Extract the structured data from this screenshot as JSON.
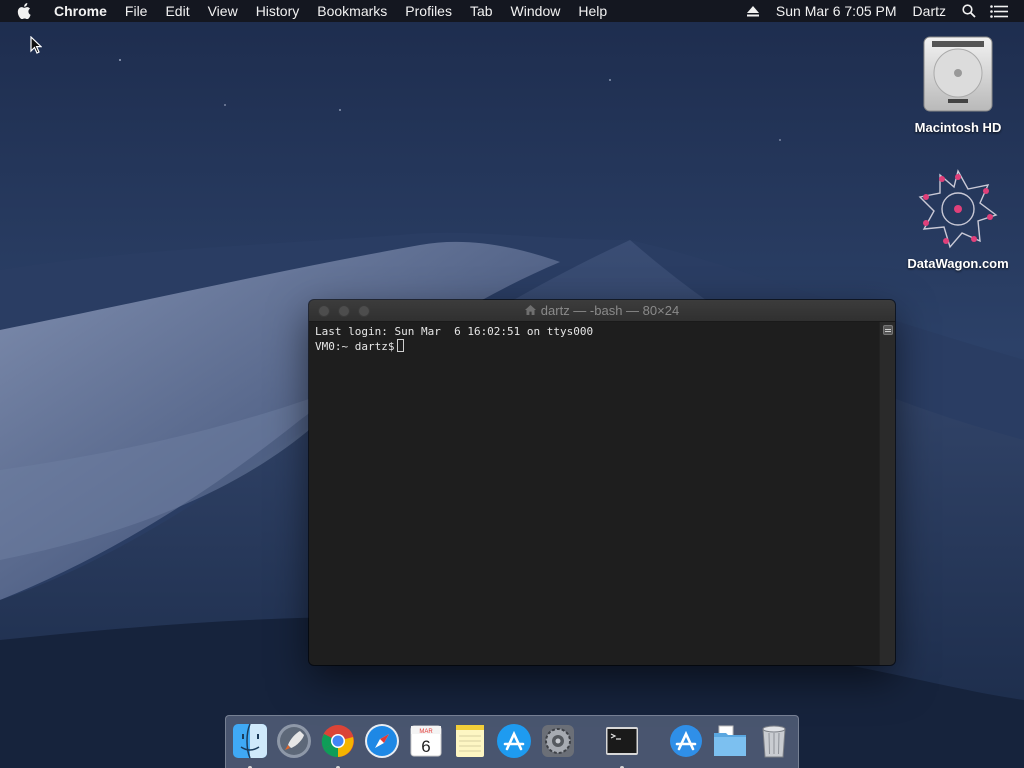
{
  "menubar": {
    "app_name": "Chrome",
    "items": [
      "File",
      "Edit",
      "View",
      "History",
      "Bookmarks",
      "Profiles",
      "Tab",
      "Window",
      "Help"
    ],
    "datetime": "Sun Mar 6  7:05 PM",
    "user": "Dartz"
  },
  "desktop": {
    "icons": [
      {
        "label": "Macintosh HD",
        "icon": "hard-drive-icon"
      },
      {
        "label": "DataWagon.com",
        "icon": "datawagon-logo-icon"
      }
    ]
  },
  "terminal": {
    "title": "dartz — -bash — 80×24",
    "lines": [
      "Last login: Sun Mar  6 16:02:51 on ttys000",
      "VM0:~ dartz$"
    ]
  },
  "dock": {
    "items": [
      {
        "name": "Finder",
        "icon": "finder-icon",
        "running": true
      },
      {
        "name": "Launchpad",
        "icon": "launchpad-icon",
        "running": false
      },
      {
        "name": "Google Chrome",
        "icon": "chrome-icon",
        "running": true
      },
      {
        "name": "Safari",
        "icon": "safari-icon",
        "running": false
      },
      {
        "name": "Calendar",
        "icon": "calendar-icon",
        "running": false,
        "month": "MAR",
        "day": "6"
      },
      {
        "name": "Notes",
        "icon": "notes-icon",
        "running": false
      },
      {
        "name": "App Store",
        "icon": "app-store-icon",
        "running": false
      },
      {
        "name": "System Preferences",
        "icon": "system-preferences-icon",
        "running": false
      },
      {
        "name": "Terminal",
        "icon": "terminal-icon",
        "running": true
      },
      {
        "name": "Applications",
        "icon": "applications-folder-icon",
        "running": false
      },
      {
        "name": "Downloads",
        "icon": "downloads-folder-icon",
        "running": false
      },
      {
        "name": "Trash",
        "icon": "trash-icon",
        "running": false
      }
    ]
  }
}
